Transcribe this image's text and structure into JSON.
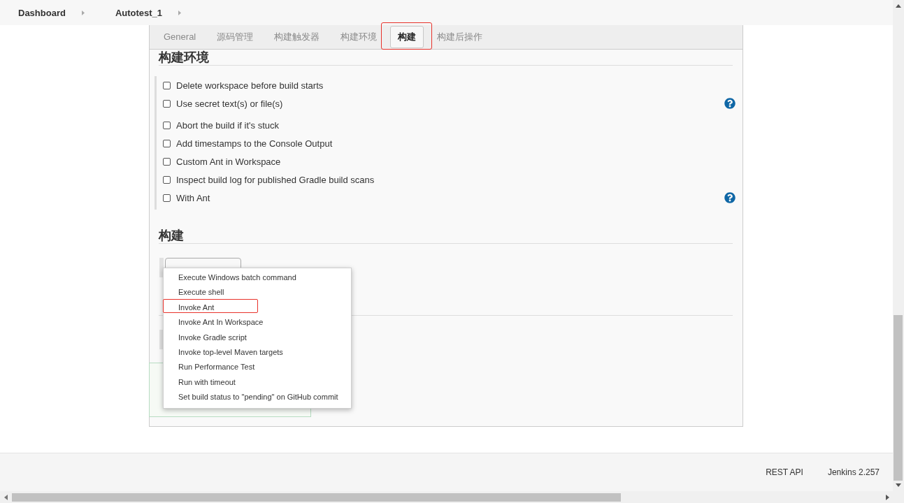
{
  "breadcrumb": [
    "Dashboard",
    "Autotest_1"
  ],
  "tabs": [
    {
      "label": "General",
      "selected": false,
      "highlighted": false
    },
    {
      "label": "源码管理",
      "selected": false,
      "highlighted": false
    },
    {
      "label": "构建触发器",
      "selected": false,
      "highlighted": false
    },
    {
      "label": "构建环境",
      "selected": false,
      "highlighted": false
    },
    {
      "label": "构建",
      "selected": true,
      "highlighted": true
    },
    {
      "label": "构建后操作",
      "selected": false,
      "highlighted": false
    }
  ],
  "sections": [
    {
      "kind": "options",
      "title": "构建环境",
      "options": [
        {
          "label": "Delete workspace before build starts",
          "checked": false,
          "help": false
        },
        {
          "label": "Use secret text(s) or file(s)",
          "checked": false,
          "help": true
        },
        {
          "label": "Abort the build if it's stuck",
          "checked": false,
          "help": false
        },
        {
          "label": "Add timestamps to the Console Output",
          "checked": false,
          "help": false
        },
        {
          "label": "Custom Ant in Workspace",
          "checked": false,
          "help": false
        },
        {
          "label": "Inspect build log for published Gradle build scans",
          "checked": false,
          "help": false
        },
        {
          "label": "With Ant",
          "checked": false,
          "help": true
        }
      ]
    },
    {
      "kind": "build_steps",
      "title": "构建",
      "add_step_menu": {
        "items": [
          {
            "label": "Execute Windows batch command",
            "highlighted": false
          },
          {
            "label": "Execute shell",
            "highlighted": false
          },
          {
            "label": "Invoke Ant",
            "highlighted": true
          },
          {
            "label": "Invoke Ant In Workspace",
            "highlighted": false
          },
          {
            "label": "Invoke Gradle script",
            "highlighted": false
          },
          {
            "label": "Invoke top-level Maven targets",
            "highlighted": false
          },
          {
            "label": "Run Performance Test",
            "highlighted": false
          },
          {
            "label": "Run with timeout",
            "highlighted": false
          },
          {
            "label": "Set build status to \"pending\" on GitHub commit",
            "highlighted": false
          }
        ]
      }
    }
  ],
  "footer": {
    "links": [
      "REST API",
      "Jenkins 2.257"
    ]
  }
}
